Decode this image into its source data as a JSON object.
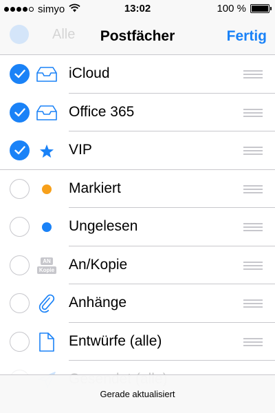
{
  "status_bar": {
    "carrier": "simyo",
    "signal_dots_filled": 4,
    "signal_dots_total": 5,
    "time": "13:02",
    "battery_text": "100 %",
    "battery_level": 1.0
  },
  "nav": {
    "ghost_label": "Alle",
    "title": "Postfächer",
    "done_label": "Fertig"
  },
  "colors": {
    "accent": "#1a82f7",
    "flag_orange": "#f7a01a",
    "unread_blue": "#1a82f7",
    "separator": "#c8c7cc"
  },
  "mailboxes": [
    {
      "label": "iCloud",
      "checked": true,
      "icon": "inbox-tray-icon"
    },
    {
      "label": "Office 365",
      "checked": true,
      "icon": "inbox-tray-icon"
    },
    {
      "label": "VIP",
      "checked": true,
      "icon": "star-icon"
    },
    {
      "label": "Markiert",
      "checked": false,
      "icon": "flag-dot-icon"
    },
    {
      "label": "Ungelesen",
      "checked": false,
      "icon": "unread-dot-icon"
    },
    {
      "label": "An/Kopie",
      "checked": false,
      "icon": "to-cc-icon",
      "icon_text_top": "AN",
      "icon_text_bottom": "Kopie"
    },
    {
      "label": "Anhänge",
      "checked": false,
      "icon": "paperclip-icon"
    },
    {
      "label": "Entwürfe (alle)",
      "checked": false,
      "icon": "document-icon"
    },
    {
      "label": "Gesendet (alle)",
      "checked": false,
      "icon": "paper-plane-icon"
    }
  ],
  "toolbar": {
    "status": "Gerade aktualisiert"
  }
}
